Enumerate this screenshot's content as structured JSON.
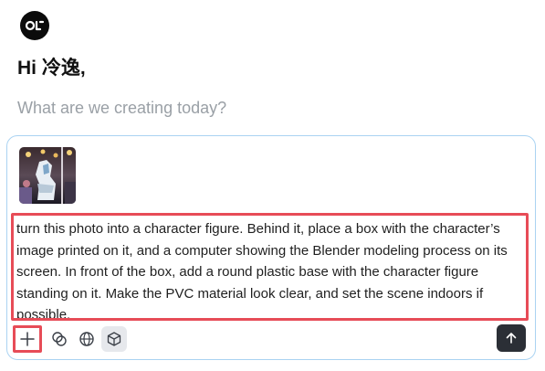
{
  "header": {
    "logo_icon": "openart-logo-icon",
    "greeting": "Hi 冷逸,",
    "subtitle": "What are we creating today?"
  },
  "composer": {
    "attachment_icon": "attached-photo-thumbnail",
    "prompt_text": "turn this photo into a character figure. Behind it, place a box with the character’s image printed on it, and a computer showing the Blender modeling process on its screen. In front of the box, add a round plastic base with the character figure standing on it. Make the PVC material look clear, and set the scene indoors if possible.",
    "tools": [
      {
        "name": "add-icon"
      },
      {
        "name": "blend-icon"
      },
      {
        "name": "globe-icon"
      },
      {
        "name": "cube-icon"
      }
    ],
    "send_icon": "arrow-up-icon"
  },
  "colors": {
    "highlight": "#e74c57",
    "composer_border": "#aad3f2",
    "send_bg": "#2b2f36",
    "subtitle": "#9aa0a6"
  }
}
